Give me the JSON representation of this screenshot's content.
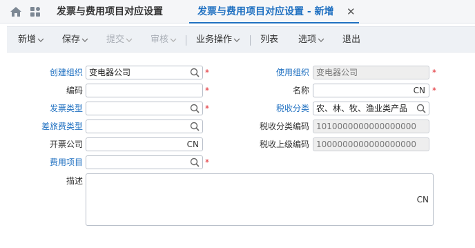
{
  "tabs": {
    "tab1": "发票与费用项目对应设置",
    "tab2": "发票与费用项目对应设置 - 新增",
    "close": "✕"
  },
  "toolbar": {
    "new": "新增",
    "save": "保存",
    "submit": "提交",
    "audit": "审核",
    "biz_ops": "业务操作",
    "list": "列表",
    "options": "选项",
    "exit": "退出"
  },
  "form": {
    "create_org_label": "创建组织",
    "create_org_value": "变电器公司",
    "use_org_label": "使用组织",
    "use_org_value": "变电器公司",
    "code_label": "编码",
    "code_value": "",
    "name_label": "名称",
    "name_lang": "CN",
    "invoice_type_label": "发票类型",
    "invoice_type_value": "",
    "tax_category_label": "税收分类",
    "tax_category_value": "农、林、牧、渔业类产品",
    "travel_expense_type_label": "差旅费类型",
    "travel_expense_type_value": "",
    "tax_category_code_label": "税收分类编码",
    "tax_category_code_value": "1010000000000000000",
    "invoicing_company_label": "开票公司",
    "invoicing_company_lang": "CN",
    "tax_parent_code_label": "税收上级编码",
    "tax_parent_code_value": "1000000000000000000",
    "expense_item_label": "费用项目",
    "expense_item_value": "",
    "description_label": "描述",
    "description_lang": "CN",
    "required_mark": "*"
  }
}
